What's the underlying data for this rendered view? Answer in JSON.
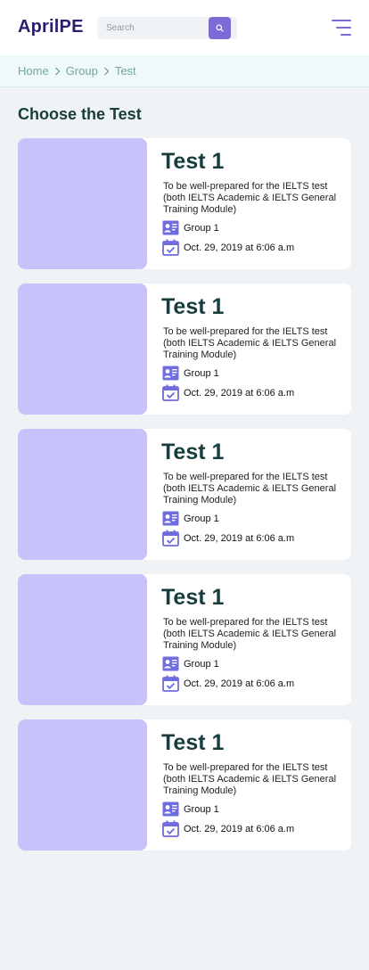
{
  "header": {
    "logo": "AprilPE",
    "search": {
      "placeholder": "Search"
    }
  },
  "breadcrumb": [
    "Home",
    "Group",
    "Test"
  ],
  "page_title": "Choose the Test",
  "tests": [
    {
      "title": "Test 1",
      "description": "To be well-prepared for the IELTS test (both IELTS Academic & IELTS General Training Module)",
      "group": "Group 1",
      "date": "Oct. 29, 2019 at 6:06 a.m"
    },
    {
      "title": "Test 1",
      "description": "To be well-prepared for the IELTS test (both IELTS Academic & IELTS General Training Module)",
      "group": "Group 1",
      "date": "Oct. 29, 2019 at 6:06 a.m"
    },
    {
      "title": "Test 1",
      "description": "To be well-prepared for the IELTS test (both IELTS Academic & IELTS General Training Module)",
      "group": "Group 1",
      "date": "Oct. 29, 2019 at 6:06 a.m"
    },
    {
      "title": "Test 1",
      "description": "To be well-prepared for the IELTS test (both IELTS Academic & IELTS General Training Module)",
      "group": "Group 1",
      "date": "Oct. 29, 2019 at 6:06 a.m"
    },
    {
      "title": "Test 1",
      "description": "To be well-prepared for the IELTS test (both IELTS Academic & IELTS General Training Module)",
      "group": "Group 1",
      "date": "Oct. 29, 2019 at 6:06 a.m"
    }
  ],
  "icons": {
    "search": "search-icon",
    "menu": "menu-icon",
    "chevron": "chevron-right-icon",
    "group": "contact-card-icon",
    "date": "calendar-check-icon"
  },
  "colors": {
    "accent": "#7d6ad6",
    "logo": "#2a1f6e",
    "thumbnail": "#c8c2fb",
    "title": "#173d3d",
    "breadcrumb": "#74a6a3"
  }
}
